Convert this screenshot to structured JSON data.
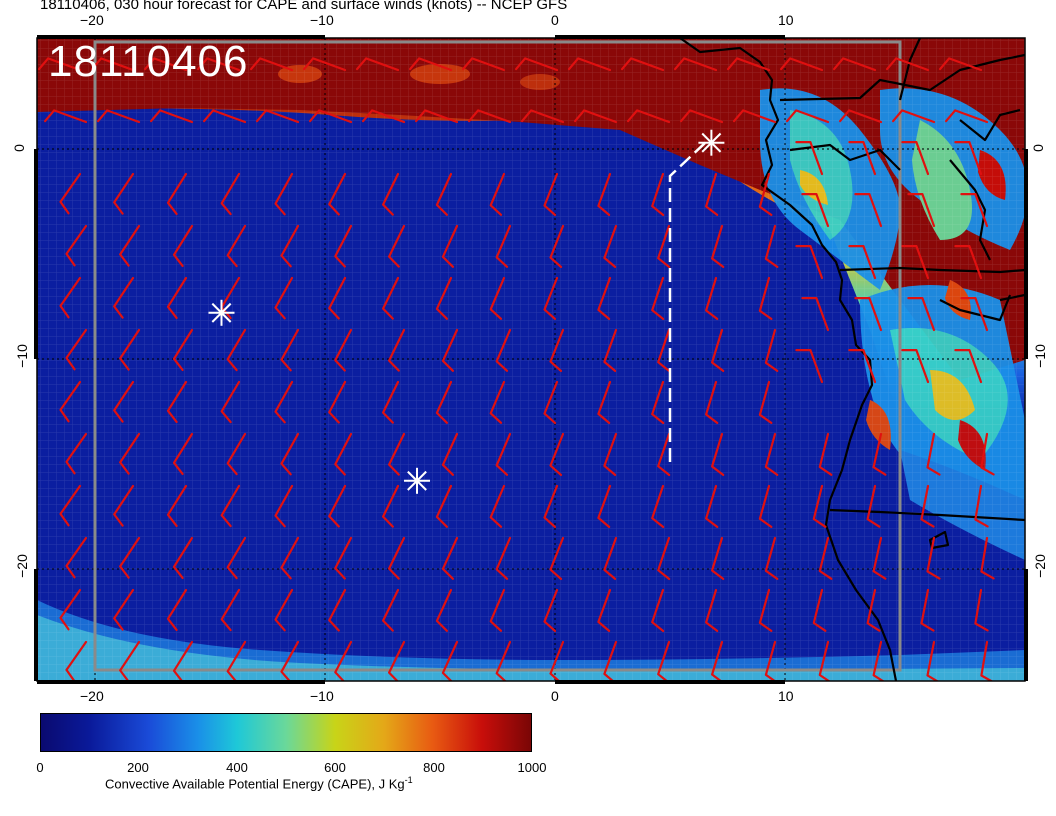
{
  "title": "18110406, 030 hour forecast for CAPE and surface winds (knots) -- NCEP GFS",
  "stamp": "18110406",
  "x_ticks": [
    "−20",
    "−10",
    "0",
    "10"
  ],
  "y_ticks": [
    "0",
    "−10",
    "−20"
  ],
  "colorbar": {
    "ticks": [
      "0",
      "200",
      "400",
      "600",
      "800",
      "1000"
    ],
    "label": "Convective Available Potential Energy (CAPE), J Kg",
    "label_sup": "-1"
  },
  "colors": {
    "ocean_cape": "#0b1ea0",
    "high_cape": "#8a0808",
    "wind_barb": "#e01010",
    "coastline": "#000000",
    "marker": "#ffffff"
  },
  "markers": [
    {
      "name": "star",
      "lon": -14.5,
      "lat": -7.8
    },
    {
      "name": "star",
      "lon": -6.0,
      "lat": -15.8
    },
    {
      "name": "star",
      "lon": 6.8,
      "lat": 0.3
    }
  ],
  "track": {
    "style": "dashed-white",
    "points": [
      [
        5.0,
        -15.0
      ],
      [
        5.0,
        -1.2
      ],
      [
        6.8,
        0.3
      ]
    ]
  }
}
